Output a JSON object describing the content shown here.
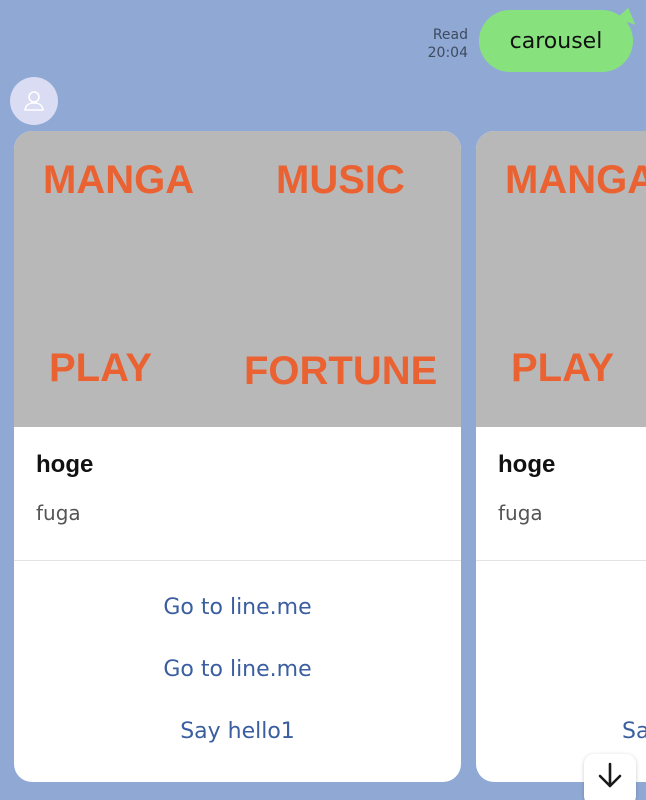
{
  "message": {
    "read_label": "Read",
    "time": "20:04",
    "text": "carousel"
  },
  "bot": {
    "avatar_icon": "user-icon"
  },
  "carousel": {
    "cards": [
      {
        "hero_words": [
          "MANGA",
          "MUSIC",
          "PLAY",
          "FORTUNE"
        ],
        "title": "hoge",
        "text": "fuga",
        "actions": [
          "Go to line.me",
          "Go to line.me",
          "Say hello1"
        ]
      },
      {
        "hero_words": [
          "MANGA",
          "PLAY"
        ],
        "title": "hoge",
        "text": "fuga",
        "actions": [
          "Sa"
        ]
      }
    ]
  },
  "scroll_down_icon": "arrow-down-icon",
  "colors": {
    "background": "#8fa9d4",
    "outgoing_bubble": "#87e27e",
    "hero_background": "#b8b8b8",
    "hero_text": "#ea6232",
    "action_text": "#3a5e9f"
  }
}
